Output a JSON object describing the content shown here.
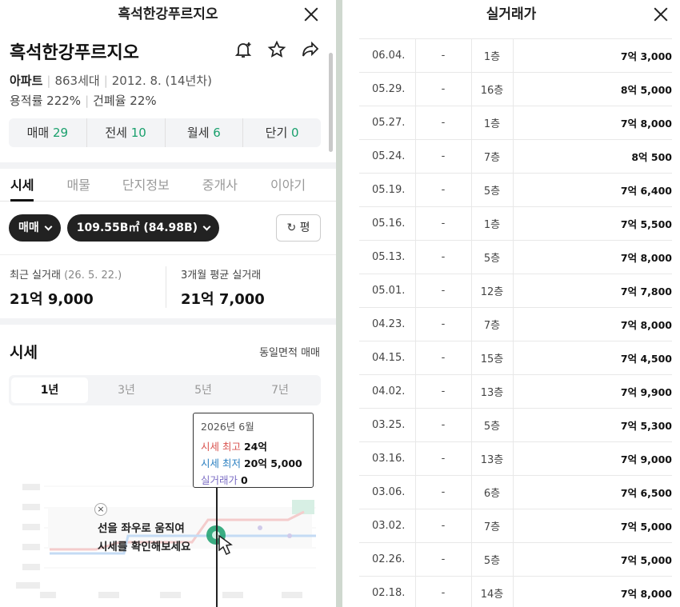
{
  "left": {
    "header_title": "흑석한강푸르지오",
    "apt_name": "흑석한강푸르지오",
    "type": "아파트",
    "households": "863세대",
    "built": "2012. 8. (14년차)",
    "far": "용적률 222%",
    "bcr": "건폐율 22%",
    "deal_counts": [
      {
        "label": "매매",
        "count": "29"
      },
      {
        "label": "전세",
        "count": "10"
      },
      {
        "label": "월세",
        "count": "6"
      },
      {
        "label": "단기",
        "count": "0"
      }
    ],
    "tabs": [
      "시세",
      "매물",
      "단지정보",
      "중개사",
      "이야기"
    ],
    "filter_deal": "매매",
    "filter_area": "109.55B㎡ (84.98B)",
    "pyeong_label": "평",
    "recent_label": "최근 실거래",
    "recent_date": "(26. 5. 22.)",
    "recent_value": "21억 9,000",
    "avg_label": "3개월 평균 실거래",
    "avg_value": "21억 7,000",
    "sise_title": "시세",
    "sise_right": "동일면적 매매",
    "periods": [
      "1년",
      "3년",
      "5년",
      "7년"
    ],
    "tooltip": {
      "date": "2026년 6월",
      "max_label": "시세 최고",
      "max_value": "24억",
      "min_label": "시세 최저",
      "min_value": "20억 5,000",
      "trade_label": "실거래가",
      "trade_value": "0"
    },
    "hint_line1": "선을 좌우로 움직여",
    "hint_line2": "시세를 확인해보세요",
    "hint_close": "×",
    "colors": {
      "accent": "#1aa06d",
      "max": "#d9534f",
      "min": "#2a7fc1",
      "trade": "#7b6cc4"
    }
  },
  "right": {
    "header_title": "실거래가",
    "rows": [
      {
        "date": "06.04.",
        "kind": "-",
        "floor": "1층",
        "price": "7억 3,000"
      },
      {
        "date": "05.29.",
        "kind": "-",
        "floor": "16층",
        "price": "8억 5,000"
      },
      {
        "date": "05.27.",
        "kind": "-",
        "floor": "1층",
        "price": "7억 8,000"
      },
      {
        "date": "05.24.",
        "kind": "-",
        "floor": "7층",
        "price": "8억 500"
      },
      {
        "date": "05.19.",
        "kind": "-",
        "floor": "5층",
        "price": "7억 6,400"
      },
      {
        "date": "05.16.",
        "kind": "-",
        "floor": "1층",
        "price": "7억 5,500"
      },
      {
        "date": "05.13.",
        "kind": "-",
        "floor": "5층",
        "price": "7억 8,000"
      },
      {
        "date": "05.01.",
        "kind": "-",
        "floor": "12층",
        "price": "7억 7,800"
      },
      {
        "date": "04.23.",
        "kind": "-",
        "floor": "7층",
        "price": "7억 8,000"
      },
      {
        "date": "04.15.",
        "kind": "-",
        "floor": "15층",
        "price": "7억 4,500"
      },
      {
        "date": "04.02.",
        "kind": "-",
        "floor": "13층",
        "price": "7억 9,900"
      },
      {
        "date": "03.25.",
        "kind": "-",
        "floor": "5층",
        "price": "7억 5,300"
      },
      {
        "date": "03.16.",
        "kind": "-",
        "floor": "13층",
        "price": "7억 9,000"
      },
      {
        "date": "03.06.",
        "kind": "-",
        "floor": "6층",
        "price": "7억 6,500"
      },
      {
        "date": "03.02.",
        "kind": "-",
        "floor": "7층",
        "price": "7억 5,000"
      },
      {
        "date": "02.26.",
        "kind": "-",
        "floor": "5층",
        "price": "7억 5,000"
      },
      {
        "date": "02.18.",
        "kind": "-",
        "floor": "14층",
        "price": "7억 8,000"
      }
    ]
  }
}
